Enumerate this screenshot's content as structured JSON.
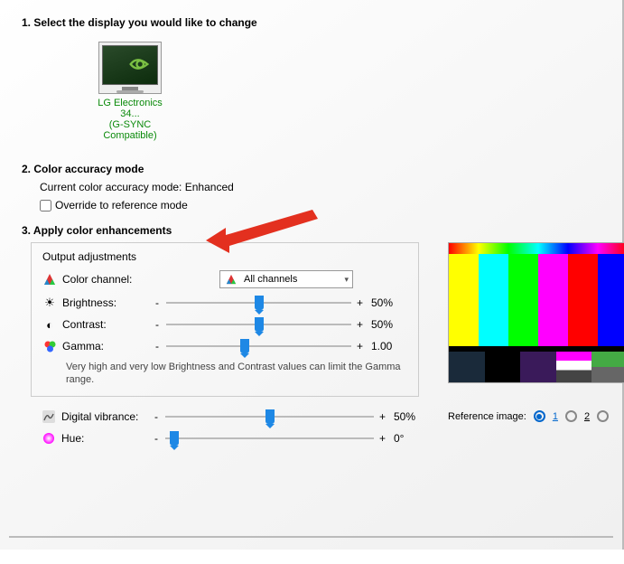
{
  "step1": {
    "title": "1. Select the display you would like to change",
    "display_name": "LG Electronics 34...",
    "display_sub": "(G-SYNC Compatible)"
  },
  "step2": {
    "title": "2. Color accuracy mode",
    "current_label": "Current color accuracy mode:",
    "current_value": "Enhanced",
    "override_label": "Override to reference mode"
  },
  "step3": {
    "title": "3. Apply color enhancements",
    "output_label": "Output adjustments",
    "channel_label": "Color channel:",
    "channel_value": "All channels",
    "brightness_label": "Brightness:",
    "brightness_value": "50%",
    "contrast_label": "Contrast:",
    "contrast_value": "50%",
    "gamma_label": "Gamma:",
    "gamma_value": "1.00",
    "note": "Very high and very low Brightness and Contrast values can limit the Gamma range.",
    "vibrance_label": "Digital vibrance:",
    "vibrance_value": "50%",
    "hue_label": "Hue:",
    "hue_value": "0°",
    "minus": "-",
    "plus": "+"
  },
  "ref": {
    "label": "Reference image:",
    "opt1": "1",
    "opt2": "2"
  }
}
